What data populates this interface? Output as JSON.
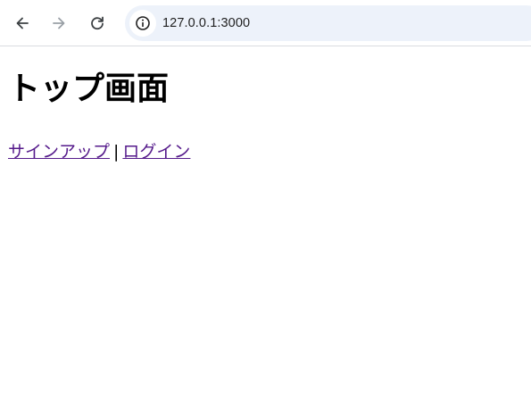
{
  "browser": {
    "url": "127.0.0.1:3000",
    "icons": {
      "back": "arrow-left-icon",
      "forward": "arrow-right-icon",
      "reload": "reload-icon",
      "site_info": "info-icon"
    },
    "colors": {
      "omnibox_bg": "#edf2fa",
      "icon_active": "#3c4043",
      "icon_disabled": "#9aa0a6"
    }
  },
  "page": {
    "heading": "トップ画面",
    "links": {
      "signup": "サインアップ",
      "separator": "|",
      "login": "ログイン"
    },
    "colors": {
      "link_visited": "#551a8b"
    }
  }
}
